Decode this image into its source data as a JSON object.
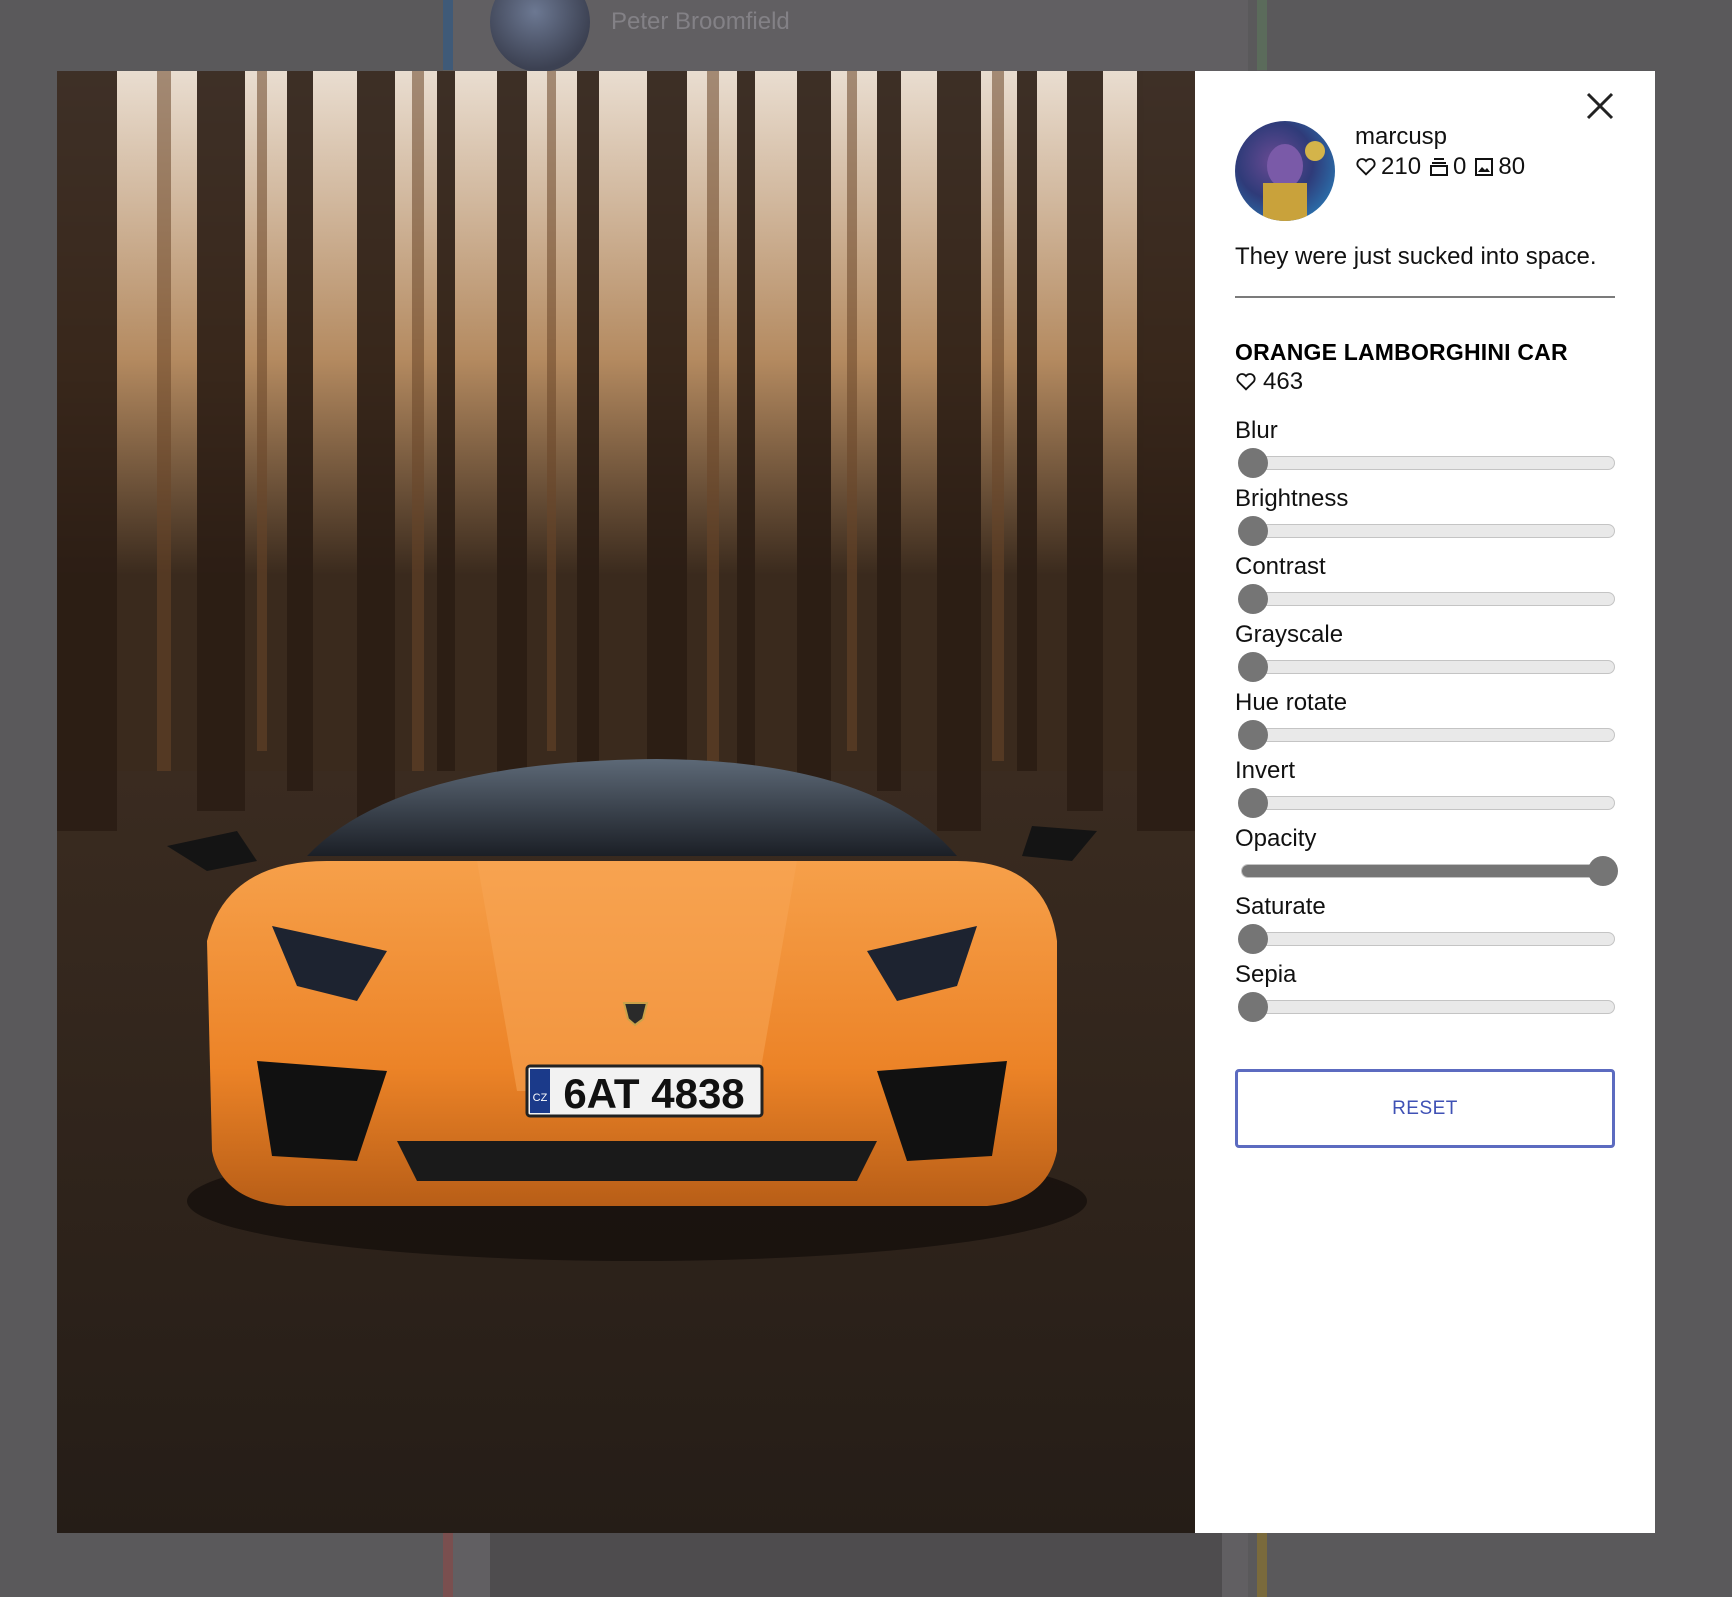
{
  "background": {
    "author_name": "Peter Broomfield"
  },
  "modal": {
    "user": {
      "username": "marcusp",
      "likes": "210",
      "collections": "0",
      "photos": "80"
    },
    "caption": "They were just sucked into space.",
    "photo_title": "ORANGE LAMBORGHINI CAR",
    "photo_likes": "463",
    "plate_text": "6AT 4838",
    "plate_country": "CZ",
    "filters": [
      {
        "label": "Blur",
        "value": 0
      },
      {
        "label": "Brightness",
        "value": 0
      },
      {
        "label": "Contrast",
        "value": 0
      },
      {
        "label": "Grayscale",
        "value": 0
      },
      {
        "label": "Hue rotate",
        "value": 0
      },
      {
        "label": "Invert",
        "value": 0
      },
      {
        "label": "Opacity",
        "value": 1
      },
      {
        "label": "Saturate",
        "value": 0
      },
      {
        "label": "Sepia",
        "value": 0
      }
    ],
    "reset_label": "RESET"
  },
  "icons": {
    "close": "close-icon",
    "likes": "heart-icon",
    "collections": "collection-icon",
    "photos": "image-icon"
  },
  "colors": {
    "overlay": "#5a595b",
    "reset_border": "#5c6bc0",
    "reset_text": "#3f51b5",
    "slider": "#757575",
    "car": "#f08a2a"
  }
}
